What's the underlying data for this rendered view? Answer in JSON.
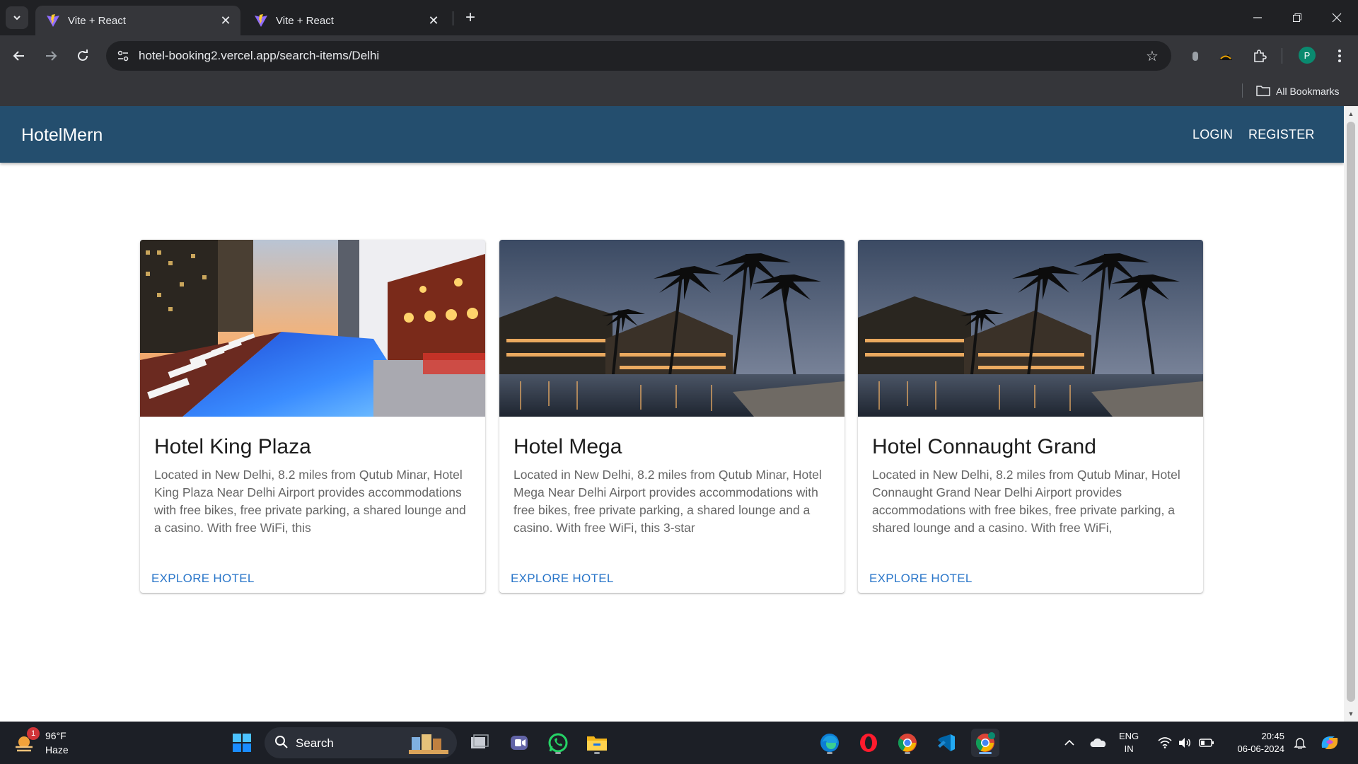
{
  "browser": {
    "tabs": [
      {
        "title": "Vite + React",
        "active": true
      },
      {
        "title": "Vite + React",
        "active": false
      }
    ],
    "url": "hotel-booking2.vercel.app/search-items/Delhi",
    "bookmarks_label": "All Bookmarks",
    "profile_initial": "P"
  },
  "app": {
    "brand": "HotelMern",
    "nav": {
      "login": "LOGIN",
      "register": "REGISTER"
    },
    "hotels": [
      {
        "name": "Hotel King Plaza",
        "description": "Located in New Delhi, 8.2 miles from Qutub Minar, Hotel King Plaza Near Delhi Airport provides accommodations with free bikes, free private parking, a shared lounge and a casino. With free WiFi, this",
        "action": "EXPLORE HOTEL",
        "image": "rooftop-pool-photo"
      },
      {
        "name": "Hotel Mega",
        "description": "Located in New Delhi, 8.2 miles from Qutub Minar, Hotel Mega Near Delhi Airport provides accommodations with free bikes, free private parking, a shared lounge and a casino. With free WiFi, this 3-star",
        "action": "EXPLORE HOTEL",
        "image": "resort-palms-photo"
      },
      {
        "name": "Hotel Connaught Grand",
        "description": "Located in New Delhi, 8.2 miles from Qutub Minar, Hotel Connaught Grand Near Delhi Airport provides accommodations with free bikes, free private parking, a shared lounge and a casino. With free WiFi,",
        "action": "EXPLORE HOTEL",
        "image": "resort-palms-photo"
      }
    ]
  },
  "taskbar": {
    "weather": {
      "temp": "96°F",
      "condition": "Haze",
      "badge": "1"
    },
    "search_label": "Search",
    "language": {
      "line1": "ENG",
      "line2": "IN"
    },
    "time": "20:45",
    "date": "06-06-2024"
  },
  "colors": {
    "appbar": "#244e6e",
    "link": "#2a76c9",
    "taskbar": "#1c1f26"
  }
}
